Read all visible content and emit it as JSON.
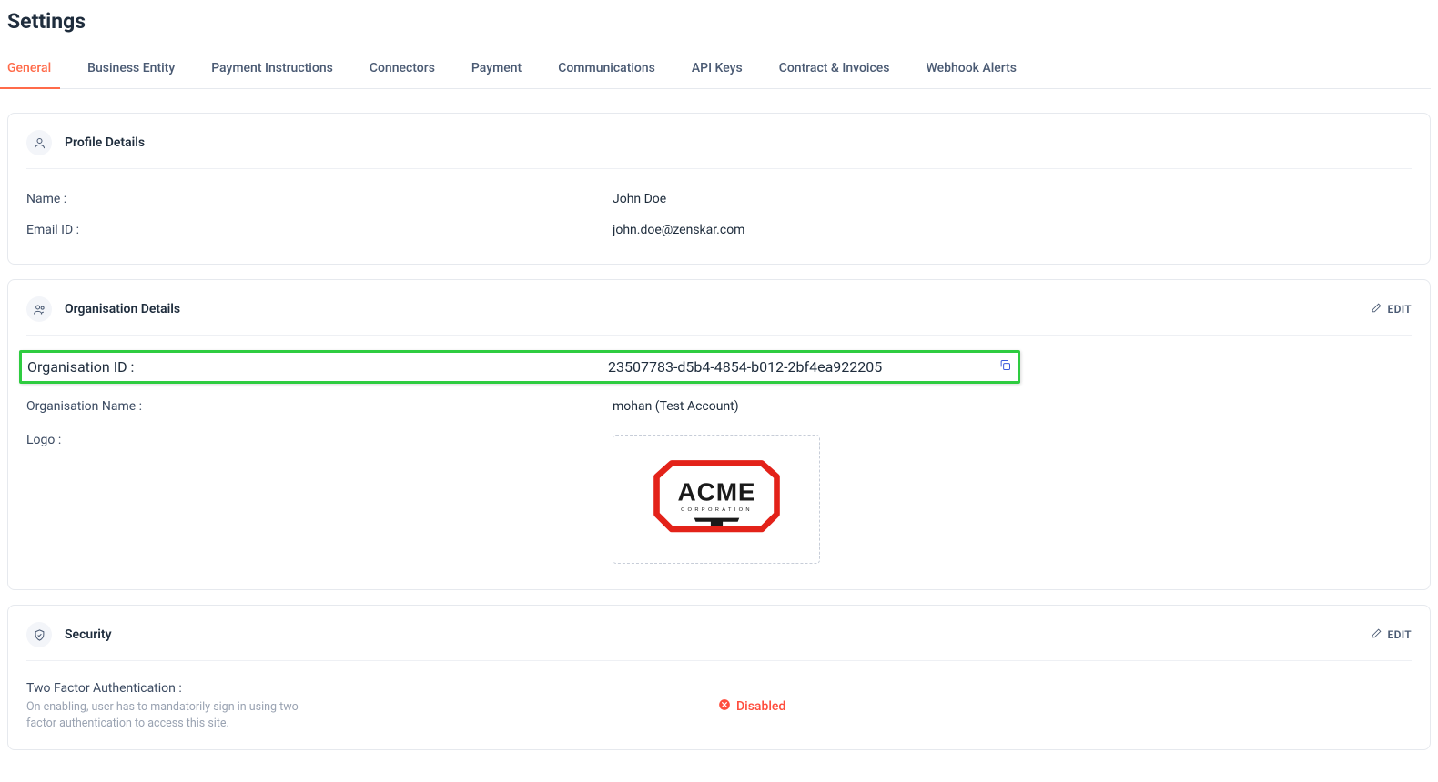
{
  "page_title": "Settings",
  "tabs": [
    {
      "label": "General",
      "active": true
    },
    {
      "label": "Business Entity",
      "active": false
    },
    {
      "label": "Payment Instructions",
      "active": false
    },
    {
      "label": "Connectors",
      "active": false
    },
    {
      "label": "Payment",
      "active": false
    },
    {
      "label": "Communications",
      "active": false
    },
    {
      "label": "API Keys",
      "active": false
    },
    {
      "label": "Contract & Invoices",
      "active": false
    },
    {
      "label": "Webhook Alerts",
      "active": false
    }
  ],
  "edit_label": "EDIT",
  "profile": {
    "title": "Profile Details",
    "name_label": "Name :",
    "name_value": "John Doe",
    "email_label": "Email ID :",
    "email_value": "john.doe@zenskar.com"
  },
  "organisation": {
    "title": "Organisation Details",
    "id_label": "Organisation ID :",
    "id_value": "23507783-d5b4-4854-b012-2bf4ea922205",
    "name_label": "Organisation Name :",
    "name_value": "mohan (Test Account)",
    "logo_label": "Logo :",
    "logo_text_main": "ACME",
    "logo_text_sub": "CORPORATION"
  },
  "security": {
    "title": "Security",
    "tfa_label": "Two Factor Authentication :",
    "tfa_helper": "On enabling, user has to mandatorily sign in using two factor authentication to access this site.",
    "tfa_status": "Disabled"
  }
}
